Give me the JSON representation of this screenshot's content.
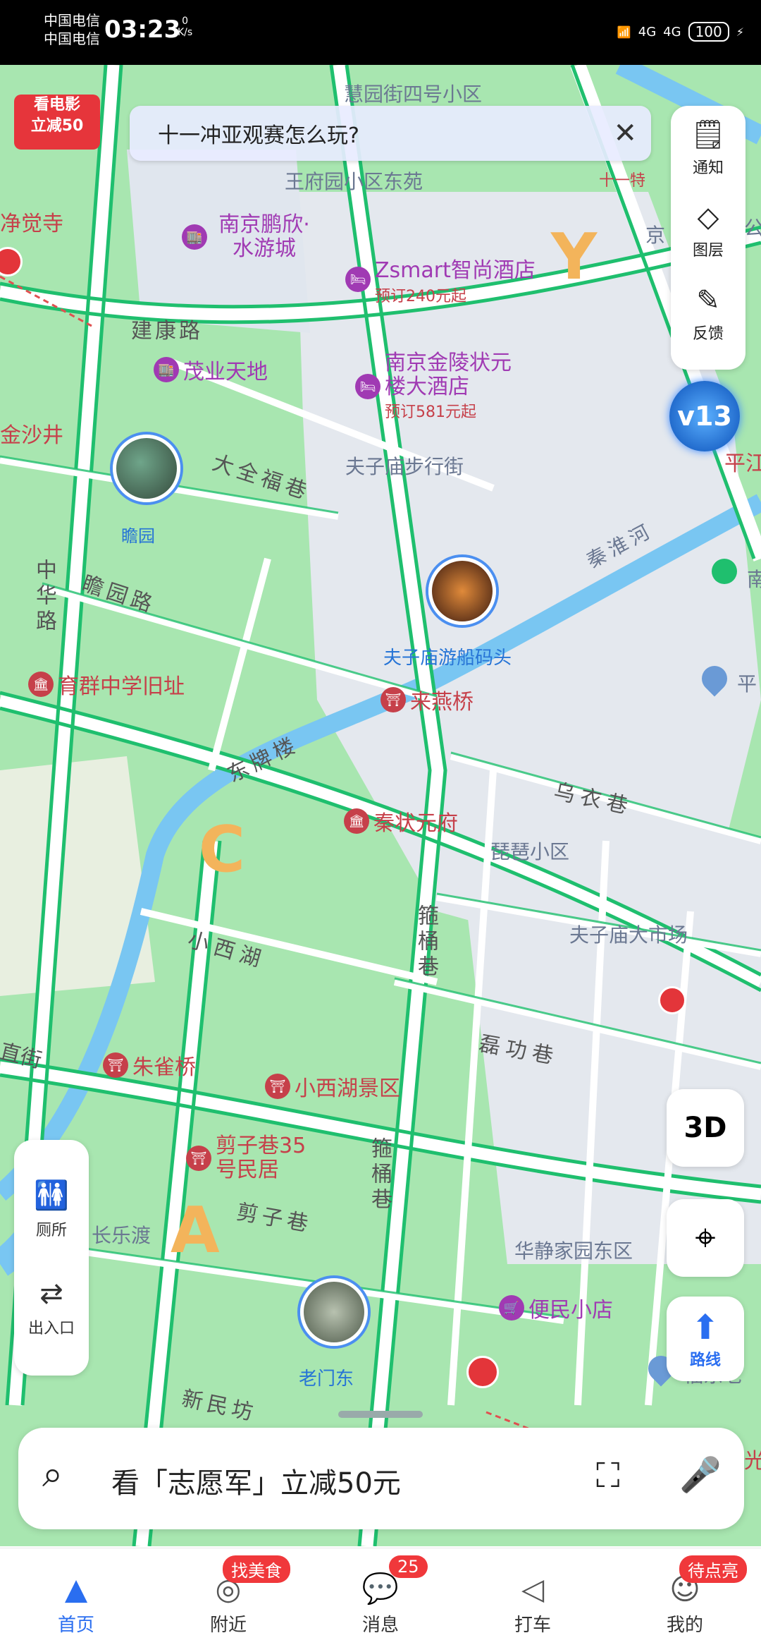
{
  "status_bar": {
    "carrier1": "中国电信",
    "carrier2": "中国电信",
    "time": "03:23",
    "speed_value": "0",
    "speed_unit": "K/s",
    "network1": "4G",
    "network2": "4G",
    "battery": "100"
  },
  "promo": {
    "line1": "看电影",
    "line2": "立减50"
  },
  "tip_bar": {
    "text": "十一冲亚观赛怎么玩?"
  },
  "right_panel": {
    "notify": "通知",
    "layers": "图层",
    "feedback": "反馈"
  },
  "vip_badge": "v13",
  "map_labels": {
    "huiyuan": "慧园街四号小区",
    "wangfu": "王府园小区东苑",
    "jingjue": "净觉寺",
    "jiankang": "建康路",
    "jinsha": "金沙井",
    "daquanfu": "大全福巷",
    "fuzimiao_walk": "夫子庙步行街",
    "zhanyuan_road": "瞻园路",
    "zhonghua": "中华路",
    "dongpai": "东牌楼",
    "qinhuai": "秦淮河",
    "wuyi": "乌衣巷",
    "pipa": "琵琶小区",
    "fuzimiao_market": "夫子庙大市场",
    "xiaoxihu_street": "小西湖",
    "gutong": "箍桶巷",
    "gutong2": "箍桶巷",
    "leigong": "磊功巷",
    "jianzi": "剪子巷",
    "changledu": "长乐渡",
    "huajing": "华静家园东区",
    "xinmin": "新民坊",
    "zhijie": "直街",
    "jing": "京",
    "gong": "公",
    "ping": "平江",
    "pingright": "平",
    "nan": "南",
    "fu": "福东老",
    "guang": "光"
  },
  "pois": {
    "pengxin": "南京鹏欣·水游城",
    "zsmart": "Zsmart智尚酒店",
    "zsmart_price": "预订240元起",
    "maoye": "茂业天地",
    "jinling": "南京金陵状元楼大酒店",
    "jinling_price": "预订581元起",
    "zhanyuan": "瞻园",
    "youchuan": "夫子庙游船码头",
    "yuqun": "育群中学旧址",
    "laiyan": "来燕桥",
    "qinzhuangyuan": "秦状元府",
    "zhuque": "朱雀桥",
    "xiaoxihu": "小西湖景区",
    "jianzi35": "剪子巷35号民居",
    "bianmin": "便民小店",
    "laomendong": "老门东",
    "hot_special": "十一特"
  },
  "left_panel": {
    "toilet": "厕所",
    "entrance": "出入口"
  },
  "map_buttons": {
    "three_d": "3D",
    "route": "路线"
  },
  "search": {
    "placeholder": "看「志愿军」立减50元"
  },
  "tabbar": {
    "home": "首页",
    "nearby": "附近",
    "nearby_badge": "找美食",
    "messages": "消息",
    "messages_badge": "25",
    "taxi": "打车",
    "mine": "我的",
    "mine_badge": "待点亮"
  },
  "colors": {
    "road_green": "#1fbf6e",
    "park_green": "#a8e6b0",
    "water": "#79c6f2",
    "accent_blue": "#2a6ef0"
  }
}
